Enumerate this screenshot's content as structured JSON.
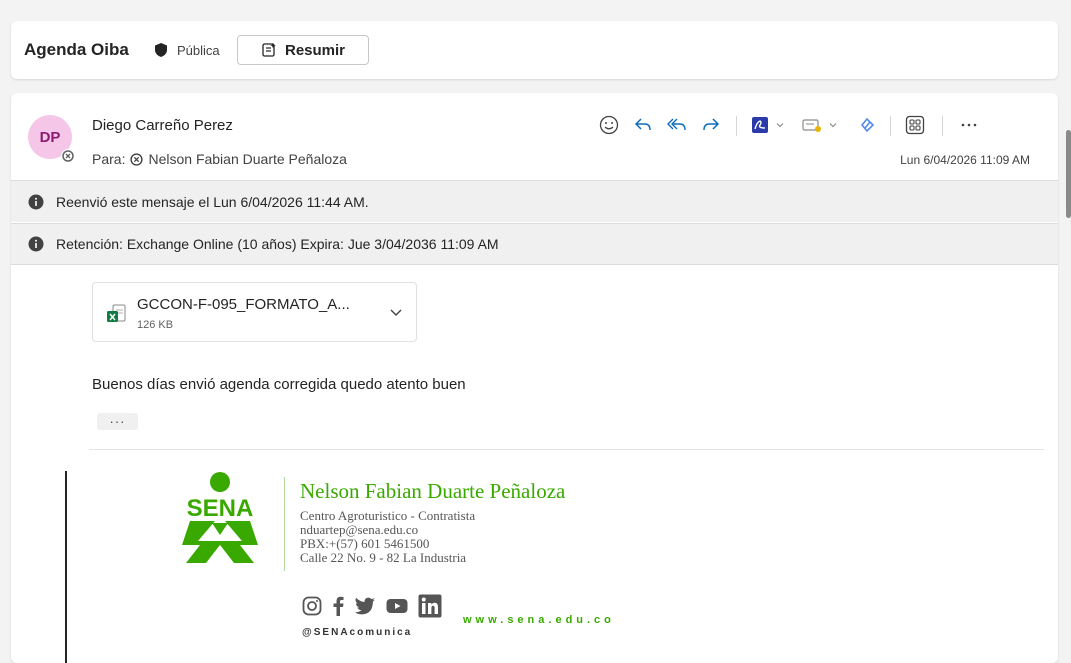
{
  "subject": {
    "title": "Agenda Oiba",
    "sensitivity": "Pública",
    "summarize_label": "Resumir"
  },
  "message": {
    "avatar_initials": "DP",
    "sender": "Diego Carreño Perez",
    "to_prefix": "Para:",
    "to_name": "Nelson Fabian Duarte Peñaloza",
    "date": "Lun 6/04/2026 11:09 AM",
    "toolbar": {
      "icons": [
        "emoji-icon",
        "reply-icon",
        "reply-all-icon",
        "forward-icon",
        "pdf-icon",
        "categorize-icon",
        "loop-icon",
        "apps-icon",
        "more-icon"
      ]
    },
    "banners": [
      "Reenvió este mensaje el Lun 6/04/2026 11:44 AM.",
      "Retención: Exchange Online (10 años) Expira: Jue 3/04/2036 11:09 AM"
    ],
    "attachment": {
      "name": "GCCON-F-095_FORMATO_A...",
      "size": "126 KB"
    },
    "body": "Buenos días envió agenda corregida quedo atento buen",
    "show_more": "···"
  },
  "signature": {
    "logo_text": "SENA",
    "name": "Nelson Fabian Duarte Peñaloza",
    "line1": "Centro Agroturistico - Contratista",
    "line2": "nduartep@sena.edu.co",
    "line3": "PBX:+(57) 601 5461500",
    "line4": "Calle 22 No. 9 - 82 La Industria",
    "website": "www.sena.edu.co",
    "handle": "@SENAcomunica",
    "social_icons": [
      "instagram-icon",
      "facebook-icon",
      "twitter-icon",
      "youtube-icon",
      "linkedin-icon"
    ]
  },
  "colors": {
    "accent": "#0f6cbd",
    "sena_green": "#39a900",
    "avatar_bg": "#f5c6e8",
    "avatar_fg": "#8a1d70"
  }
}
